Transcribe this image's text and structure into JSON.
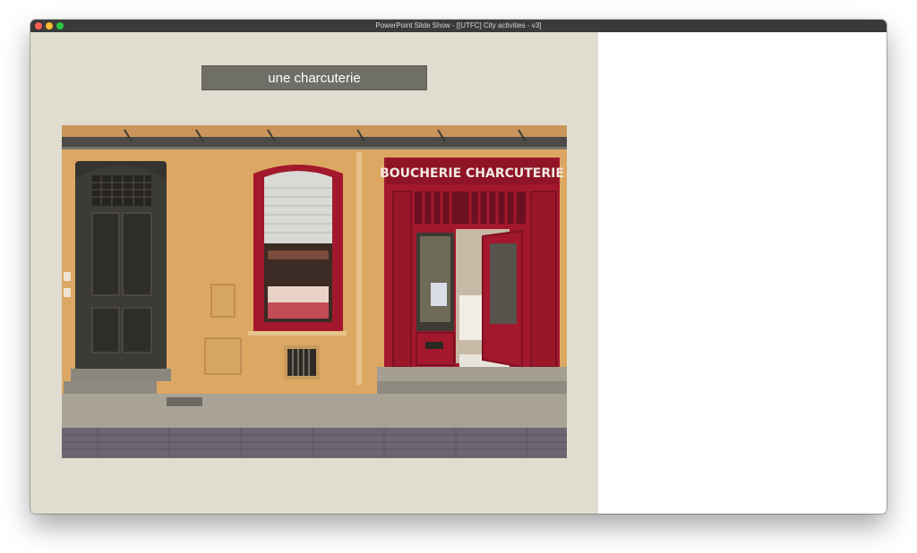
{
  "window": {
    "title": "PowerPoint Slide Show - [[UTFC] City activities - v3]",
    "controls": [
      "close",
      "minimize",
      "zoom"
    ]
  },
  "slide": {
    "title": "une charcuterie",
    "image": {
      "description_name": "butcher-shop-storefront-photo",
      "sign_text": "BOUCHERIE CHARCUTERIE"
    }
  },
  "colors": {
    "slide_background": "#e0ddd0",
    "title_box": "#6f6e67",
    "shopfront_red": "#a3182c",
    "wall_ochre": "#dca763"
  }
}
